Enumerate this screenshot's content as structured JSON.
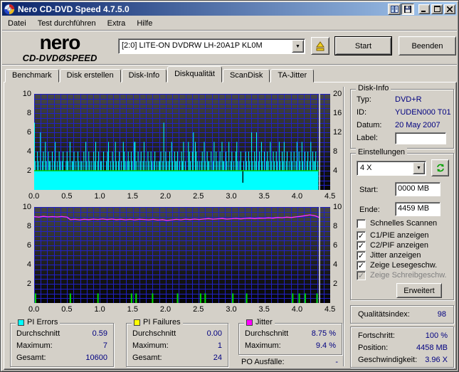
{
  "window": {
    "title": "Nero CD-DVD Speed 4.7.5.0"
  },
  "menu": {
    "items": [
      "Datei",
      "Test durchführen",
      "Extra",
      "Hilfe"
    ]
  },
  "logo": {
    "line1": "nero",
    "line2a": "CD-DVD",
    "disc_glyph": "Ø",
    "line2b": "SPEED"
  },
  "header": {
    "drive": "[2:0]   LITE-ON DVDRW LH-20A1P KL0M",
    "start_label": "Start",
    "quit_label": "Beenden"
  },
  "tabs": [
    "Benchmark",
    "Disk erstellen",
    "Disk-Info",
    "Diskqualität",
    "ScanDisk",
    "TA-Jitter"
  ],
  "disk_info": {
    "legend": "Disk-Info",
    "rows": [
      {
        "label": "Typ:",
        "value": "DVD+R"
      },
      {
        "label": "ID:",
        "value": "YUDEN000 T01"
      },
      {
        "label": "Datum:",
        "value": "20 May 2007"
      }
    ],
    "label_label": "Label:",
    "label_value": ""
  },
  "settings": {
    "legend": "Einstellungen",
    "speed_value": "4 X",
    "start_label": "Start:",
    "start_value": "0000 MB",
    "end_label": "Ende:",
    "end_value": "4459 MB",
    "checkboxes": [
      {
        "label": "Schnelles Scannen",
        "checked": false,
        "disabled": false
      },
      {
        "label": "C1/PIE anzeigen",
        "checked": true,
        "disabled": false
      },
      {
        "label": "C2/PIF anzeigen",
        "checked": true,
        "disabled": false
      },
      {
        "label": "Jitter anzeigen",
        "checked": true,
        "disabled": false
      },
      {
        "label": "Zeige Lesegeschw.",
        "checked": true,
        "disabled": false
      },
      {
        "label": "Zeige Schreibgeschw.",
        "checked": true,
        "disabled": true
      }
    ],
    "advanced_label": "Erweitert"
  },
  "quality": {
    "label": "Qualitätsindex:",
    "value": "98"
  },
  "progress": {
    "rows": [
      {
        "label": "Fortschritt:",
        "value": "100 %"
      },
      {
        "label": "Position:",
        "value": "4458 MB"
      },
      {
        "label": "Geschwindigkeit:",
        "value": "3.96 X"
      }
    ]
  },
  "stats": {
    "pi_errors": {
      "legend": "PI Errors",
      "swatch": "#00ffff",
      "rows": [
        {
          "label": "Durchschnitt",
          "value": "0.59"
        },
        {
          "label": "Maximum:",
          "value": "7"
        },
        {
          "label": "Gesamt:",
          "value": "10600"
        }
      ]
    },
    "pi_failures": {
      "legend": "PI Failures",
      "swatch": "#ffff00",
      "rows": [
        {
          "label": "Durchschnitt",
          "value": "0.00"
        },
        {
          "label": "Maximum:",
          "value": "1"
        },
        {
          "label": "Gesamt:",
          "value": "24"
        }
      ]
    },
    "jitter": {
      "legend": "Jitter",
      "swatch": "#ff00ff",
      "rows": [
        {
          "label": "Durchschnitt",
          "value": "8.75 %"
        },
        {
          "label": "Maximum:",
          "value": "9.4 %"
        }
      ]
    },
    "po_label": "PO Ausfälle:",
    "po_value": "-"
  },
  "chart_data": [
    {
      "type": "bar",
      "title": "PI Errors vs. disk position (GB)",
      "x_range": [
        0,
        4.5
      ],
      "x_ticks": [
        "0.0",
        "0.5",
        "1.0",
        "1.5",
        "2.0",
        "2.5",
        "3.0",
        "3.5",
        "4.0",
        "4.5"
      ],
      "ylim": [
        0,
        10
      ],
      "y_ticks_left": [
        "2",
        "4",
        "6",
        "8",
        "10"
      ],
      "y2lim": [
        0,
        20
      ],
      "y_ticks_right": [
        "4",
        "8",
        "12",
        "16",
        "20"
      ],
      "grid": {
        "x_step": 0.1,
        "y_step": 0.5,
        "color": "#2121c8",
        "on": true
      },
      "bg_gradient": [
        "#474747",
        "#040404"
      ],
      "bar_color": "#00ffff",
      "bar_x_step": 0.015,
      "baseline": 2,
      "data_end_x": 4.32,
      "bar_heights": "732432623425324332423523243234223432523342324323324253243232435234233242234523243253234232543234324325532423423523243243234232334237243234253243342324352322543246254323234253243324235243234253324325234232453234213243243263243623425324234325324324325324352342324324235243253242342352433423",
      "notches": [
        {
          "x": 3.165,
          "low": 0.75
        }
      ],
      "speed_line": {
        "label": "read-speed-4x",
        "y": 2,
        "color": "#00c800",
        "x_end": 4.33
      },
      "cursor": {
        "x": 4.33,
        "color": "#ebebeb"
      }
    },
    {
      "type": "line",
      "title": "Jitter (%) and PI Failures vs. disk position (GB)",
      "x_range": [
        0,
        4.5
      ],
      "x_ticks": [
        "0.0",
        "0.5",
        "1.0",
        "1.5",
        "2.0",
        "2.5",
        "3.0",
        "3.5",
        "4.0",
        "4.5"
      ],
      "ylim": [
        0,
        10
      ],
      "y_ticks_left": [
        "2",
        "4",
        "6",
        "8",
        "10"
      ],
      "y_ticks_right": [
        "2",
        "4",
        "6",
        "8",
        "10"
      ],
      "grid": {
        "x_step": 0.1,
        "y_step": 0.5,
        "color": "#2121c8",
        "on": true
      },
      "bg_gradient": [
        "#474747",
        "#040404"
      ],
      "jitter_line": {
        "name": "Jitter",
        "color": "#ff30ff",
        "points": [
          [
            0,
            9.0
          ],
          [
            0.07,
            8.95
          ],
          [
            0.14,
            9.02
          ],
          [
            0.21,
            8.97
          ],
          [
            0.28,
            9.0
          ],
          [
            0.35,
            8.96
          ],
          [
            0.42,
            9.01
          ],
          [
            0.5,
            8.95
          ],
          [
            0.55,
            8.68
          ],
          [
            0.62,
            8.72
          ],
          [
            0.69,
            8.66
          ],
          [
            0.76,
            8.72
          ],
          [
            0.83,
            8.68
          ],
          [
            0.9,
            8.73
          ],
          [
            0.97,
            8.7
          ],
          [
            1.04,
            8.75
          ],
          [
            1.11,
            8.69
          ],
          [
            1.18,
            8.74
          ],
          [
            1.25,
            8.68
          ],
          [
            1.32,
            8.72
          ],
          [
            1.39,
            8.67
          ],
          [
            1.46,
            8.71
          ],
          [
            1.53,
            8.66
          ],
          [
            1.6,
            8.72
          ],
          [
            1.67,
            8.7
          ],
          [
            1.74,
            8.66
          ],
          [
            1.81,
            8.71
          ],
          [
            1.88,
            8.64
          ],
          [
            1.95,
            8.68
          ],
          [
            2.02,
            8.6
          ],
          [
            2.09,
            8.66
          ],
          [
            2.16,
            8.71
          ],
          [
            2.23,
            8.67
          ],
          [
            2.3,
            8.73
          ],
          [
            2.37,
            8.69
          ],
          [
            2.44,
            8.74
          ],
          [
            2.51,
            8.7
          ],
          [
            2.58,
            8.75
          ],
          [
            2.65,
            8.79
          ],
          [
            2.72,
            8.73
          ],
          [
            2.79,
            8.77
          ],
          [
            2.86,
            8.8
          ],
          [
            2.93,
            8.74
          ],
          [
            3.0,
            8.78
          ],
          [
            3.07,
            8.81
          ],
          [
            3.14,
            8.76
          ],
          [
            3.21,
            8.81
          ],
          [
            3.28,
            8.84
          ],
          [
            3.35,
            8.79
          ],
          [
            3.42,
            8.84
          ],
          [
            3.49,
            8.82
          ],
          [
            3.56,
            8.87
          ],
          [
            3.63,
            8.84
          ],
          [
            3.7,
            8.9
          ],
          [
            3.77,
            8.88
          ],
          [
            3.84,
            8.94
          ],
          [
            3.91,
            8.9
          ],
          [
            3.98,
            8.97
          ],
          [
            4.05,
            9.02
          ],
          [
            4.12,
            9.1
          ],
          [
            4.19,
            9.18
          ],
          [
            4.24,
            9.12
          ],
          [
            4.28,
            9.05
          ],
          [
            4.33,
            8.92
          ]
        ]
      },
      "pif_bars": {
        "name": "PI Failures",
        "color": "#00dc00",
        "height": 1,
        "x": [
          0.02,
          0.55,
          0.97,
          1.48,
          1.55,
          1.8,
          2.18,
          2.53,
          2.6,
          3.02,
          3.23,
          3.93,
          4.03,
          4.12,
          4.3
        ]
      },
      "cursor": {
        "x": 4.33,
        "color": "#ebebeb"
      }
    }
  ]
}
